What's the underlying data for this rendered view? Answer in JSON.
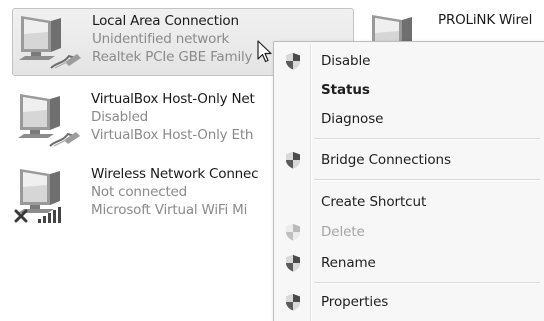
{
  "connections": [
    {
      "name": "Local Area Connection",
      "status": "Unidentified network",
      "device": "Realtek PCIe GBE Family",
      "selected": true,
      "icon": "wired-network-icon"
    },
    {
      "name": "PROLiNK Wirel",
      "status": "",
      "device": "",
      "selected": false,
      "icon": "wireless-network-icon"
    },
    {
      "name": "VirtualBox Host-Only Net",
      "status": "Disabled",
      "device": "VirtualBox Host-Only Eth",
      "selected": false,
      "icon": "wired-network-icon"
    },
    {
      "name": "Wireless Network Connec",
      "status": "Not connected",
      "device": "Microsoft Virtual WiFi Mi",
      "selected": false,
      "icon": "wireless-network-icon"
    }
  ],
  "context_menu": {
    "items": [
      {
        "label": "Disable",
        "icon": "shield-icon",
        "bold": false,
        "disabled": false
      },
      {
        "label": "Status",
        "icon": "",
        "bold": true,
        "disabled": false
      },
      {
        "label": "Diagnose",
        "icon": "",
        "bold": false,
        "disabled": false
      },
      {
        "label": "Bridge Connections",
        "icon": "shield-icon",
        "bold": false,
        "disabled": false
      },
      {
        "label": "Create Shortcut",
        "icon": "",
        "bold": false,
        "disabled": false
      },
      {
        "label": "Delete",
        "icon": "shield-icon",
        "bold": false,
        "disabled": true
      },
      {
        "label": "Rename",
        "icon": "shield-icon",
        "bold": false,
        "disabled": false
      },
      {
        "label": "Properties",
        "icon": "shield-icon",
        "bold": false,
        "disabled": false
      }
    ]
  },
  "colors": {
    "text": "#1e1e1e",
    "subtext": "#8a8a8a",
    "disabled_text": "#a4a4a4",
    "menu_background": "#f7f7f7",
    "selection": "#e8e8e8"
  }
}
